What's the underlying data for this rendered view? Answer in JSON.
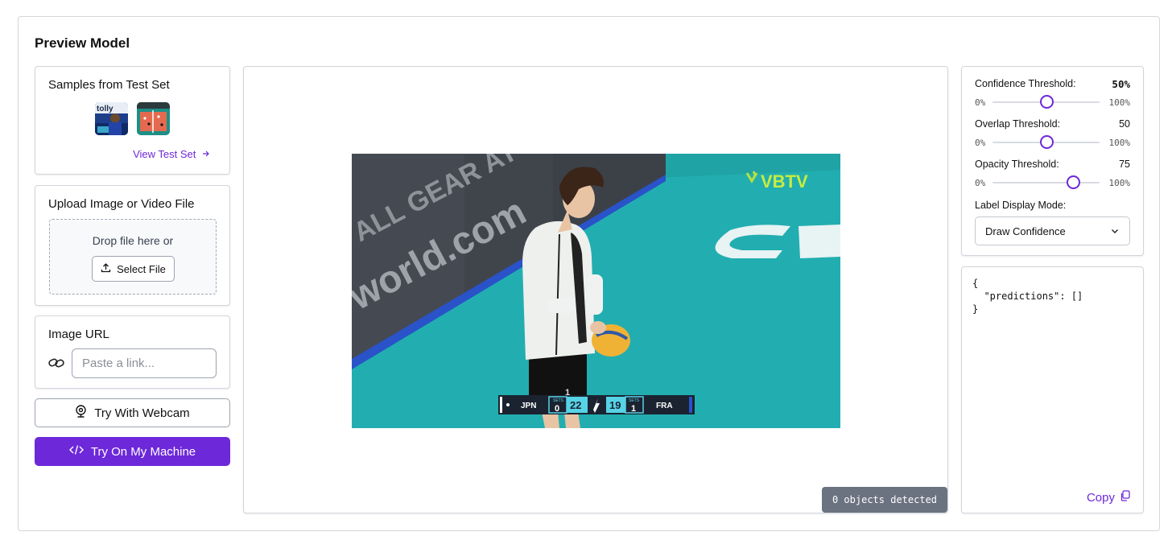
{
  "page": {
    "title": "Preview Model"
  },
  "samples": {
    "title": "Samples from Test Set",
    "thumbnails": [
      {
        "name": "sample-1"
      },
      {
        "name": "sample-2"
      }
    ],
    "view_link": "View Test Set",
    "view_icon": "arrow-right-icon"
  },
  "upload": {
    "title": "Upload Image or Video File",
    "drop_text": "Drop file here or",
    "select_label": "Select File",
    "select_icon": "upload-icon"
  },
  "url": {
    "title": "Image URL",
    "placeholder": "Paste a link...",
    "icon": "link-icon"
  },
  "buttons": {
    "webcam_label": "Try With Webcam",
    "webcam_icon": "webcam-icon",
    "machine_label": "Try On My Machine",
    "machine_icon": "code-icon"
  },
  "preview": {
    "image_texts": {
      "brand": "VBTV",
      "banner_1": "ALL GEAR AT",
      "banner_2": "world.com",
      "team_left": "JPN",
      "sets_left": "0",
      "score_left": "22",
      "score_right": "19",
      "sets_right": "1",
      "team_right": "FRA",
      "sets_caption": "SETS",
      "jersey": "1"
    },
    "objects_detected": "0 objects detected"
  },
  "settings": {
    "confidence": {
      "label": "Confidence Threshold:",
      "value": "50%",
      "min": "0%",
      "max": "100%",
      "level": 0.5
    },
    "overlap": {
      "label": "Overlap Threshold:",
      "value": "50",
      "min": "0%",
      "max": "100%",
      "level": 0.5
    },
    "opacity": {
      "label": "Opacity Threshold:",
      "value": "75",
      "min": "0%",
      "max": "100%",
      "level": 0.75
    },
    "label_mode": {
      "label": "Label Display Mode:",
      "selected": "Draw Confidence"
    }
  },
  "json_output": {
    "text": "{\n  \"predictions\": []\n}",
    "copy_label": "Copy",
    "copy_icon": "copy-icon"
  },
  "colors": {
    "accent": "#6d28d9",
    "badge": "#6b7280",
    "court": "#1fa5a7"
  }
}
